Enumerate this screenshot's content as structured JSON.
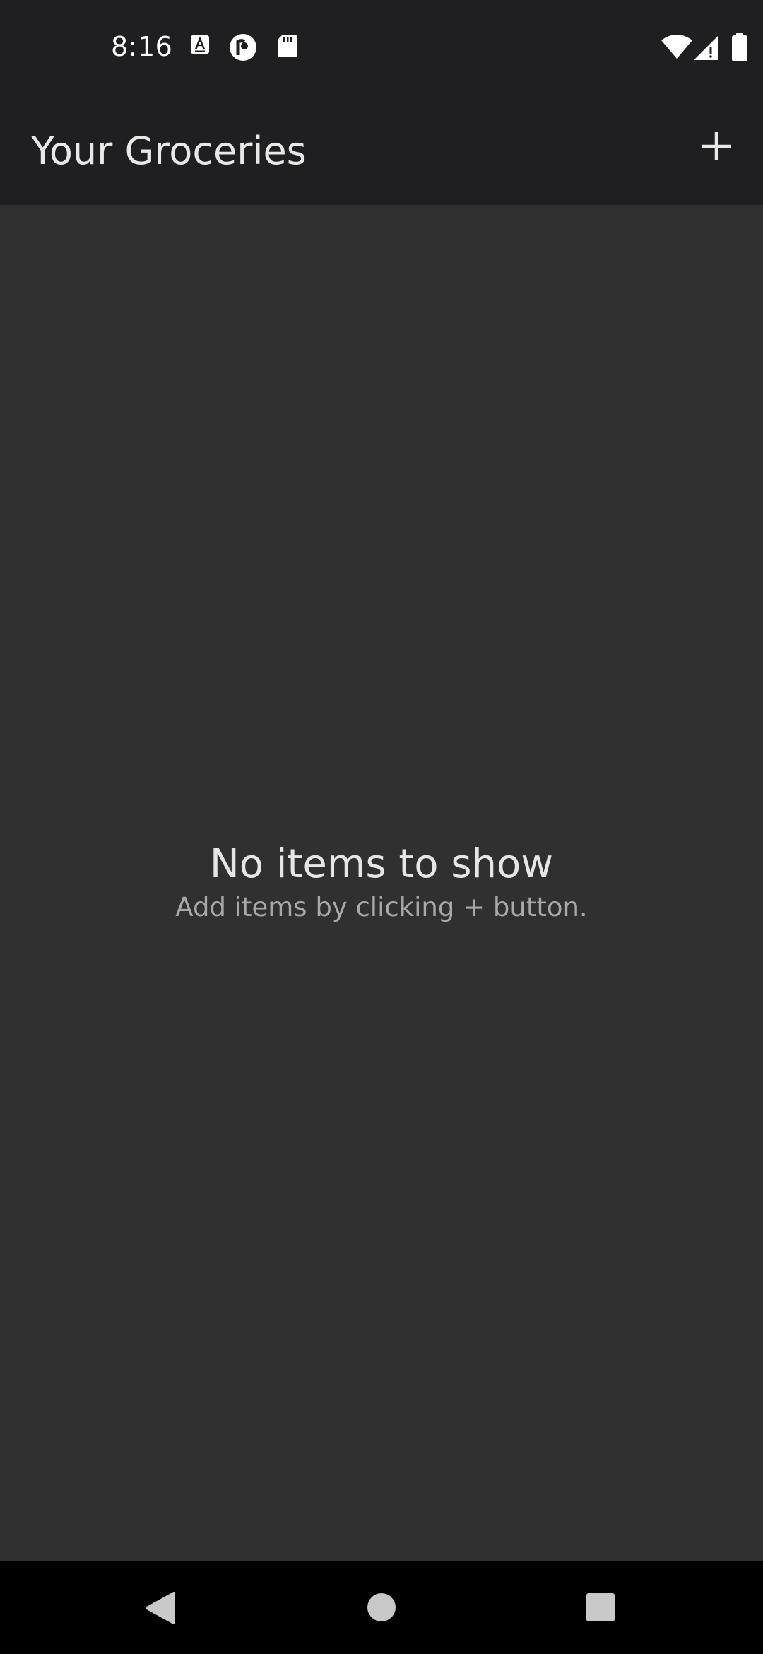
{
  "status_bar": {
    "time": "8:16",
    "left_icons": [
      "text-a-icon",
      "pocket-casts-icon",
      "sd-card-icon"
    ],
    "right_icons": [
      "wifi-icon",
      "cell-signal-icon",
      "battery-icon"
    ]
  },
  "app_bar": {
    "title": "Your Groceries",
    "add_icon": "plus-icon"
  },
  "empty_state": {
    "title": "No items to show",
    "subtitle": "Add items by clicking + button."
  },
  "nav_bar": {
    "buttons": [
      "back-icon",
      "home-icon",
      "recents-icon"
    ]
  },
  "colors": {
    "background": "#303030",
    "bar": "#1f1f21",
    "nav": "#000000",
    "text_primary": "#e6e6e6",
    "text_secondary": "#a9a9a9"
  }
}
